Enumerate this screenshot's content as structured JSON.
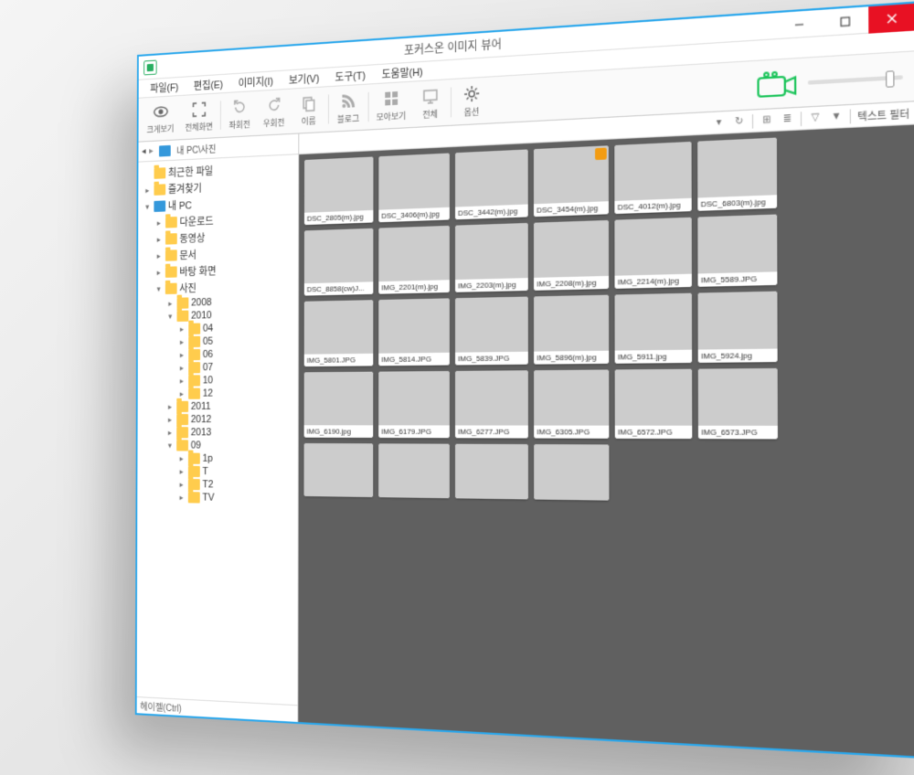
{
  "window": {
    "title": "포커스온 이미지 뷰어"
  },
  "menu": [
    "파일(F)",
    "편집(E)",
    "이미지(I)",
    "보기(V)",
    "도구(T)",
    "도움말(H)"
  ],
  "toolbar": {
    "items": [
      {
        "icon": "eye",
        "label": "크게보기"
      },
      {
        "icon": "fullscreen",
        "label": "전체화면"
      },
      {
        "icon": "rotate-left",
        "label": "좌회전"
      },
      {
        "icon": "rotate-right",
        "label": "우회전"
      },
      {
        "icon": "copy",
        "label": "이름"
      },
      {
        "icon": "rss",
        "label": "블로그"
      },
      {
        "icon": "grid",
        "label": "모아보기"
      },
      {
        "icon": "screen",
        "label": "전체"
      },
      {
        "icon": "gear",
        "label": "옵션"
      }
    ]
  },
  "breadcrumb": {
    "path": "내 PC\\사진"
  },
  "tree": [
    {
      "depth": 0,
      "arrow": "",
      "icon": "folder",
      "label": "최근한 파일"
    },
    {
      "depth": 0,
      "arrow": "▸",
      "icon": "folder",
      "label": "즐겨찾기"
    },
    {
      "depth": 0,
      "arrow": "▾",
      "icon": "pc",
      "label": "내 PC"
    },
    {
      "depth": 1,
      "arrow": "▸",
      "icon": "folder",
      "label": "다운로드"
    },
    {
      "depth": 1,
      "arrow": "▸",
      "icon": "folder",
      "label": "동영상"
    },
    {
      "depth": 1,
      "arrow": "▸",
      "icon": "folder",
      "label": "문서"
    },
    {
      "depth": 1,
      "arrow": "▸",
      "icon": "folder",
      "label": "바탕 화면"
    },
    {
      "depth": 1,
      "arrow": "▾",
      "icon": "folder",
      "label": "사진"
    },
    {
      "depth": 2,
      "arrow": "▸",
      "icon": "folder",
      "label": "2008"
    },
    {
      "depth": 2,
      "arrow": "▾",
      "icon": "folder",
      "label": "2010"
    },
    {
      "depth": 3,
      "arrow": "▸",
      "icon": "folder",
      "label": "04"
    },
    {
      "depth": 3,
      "arrow": "▸",
      "icon": "folder",
      "label": "05"
    },
    {
      "depth": 3,
      "arrow": "▸",
      "icon": "folder",
      "label": "06"
    },
    {
      "depth": 3,
      "arrow": "▸",
      "icon": "folder",
      "label": "07"
    },
    {
      "depth": 3,
      "arrow": "▸",
      "icon": "folder",
      "label": "10"
    },
    {
      "depth": 3,
      "arrow": "▸",
      "icon": "folder",
      "label": "12"
    },
    {
      "depth": 2,
      "arrow": "▸",
      "icon": "folder",
      "label": "2011"
    },
    {
      "depth": 2,
      "arrow": "▸",
      "icon": "folder",
      "label": "2012"
    },
    {
      "depth": 2,
      "arrow": "▸",
      "icon": "folder",
      "label": "2013"
    },
    {
      "depth": 2,
      "arrow": "▾",
      "icon": "folder",
      "label": "09"
    },
    {
      "depth": 3,
      "arrow": "▸",
      "icon": "folder",
      "label": "1p"
    },
    {
      "depth": 3,
      "arrow": "▸",
      "icon": "folder",
      "label": "T"
    },
    {
      "depth": 3,
      "arrow": "▸",
      "icon": "folder",
      "label": "T2"
    },
    {
      "depth": 3,
      "arrow": "▸",
      "icon": "folder",
      "label": "TV"
    }
  ],
  "status": {
    "label": "헤이젤(Ctrl)"
  },
  "viewbar": {
    "filter_label": "텍스트 필터"
  },
  "thumbs": [
    [
      {
        "name": "DSC_2805(m).jpg",
        "p": "p0"
      },
      {
        "name": "DSC_3406(m).jpg",
        "p": "p1"
      },
      {
        "name": "DSC_3442(m).jpg",
        "p": "p2"
      },
      {
        "name": "DSC_3454(m).jpg",
        "p": "p3",
        "edit": true
      },
      {
        "name": "DSC_4012(m).jpg",
        "p": "p4"
      },
      {
        "name": "DSC_6803(m).jpg",
        "p": "p5"
      }
    ],
    [
      {
        "name": "DSC_8858(cw)J...",
        "p": "p6"
      },
      {
        "name": "IMG_2201(m).jpg",
        "p": "p7"
      },
      {
        "name": "IMG_2203(m).jpg",
        "p": "p8"
      },
      {
        "name": "IMG_2208(m).jpg",
        "p": "p9"
      },
      {
        "name": "IMG_2214(m).jpg",
        "p": "p10"
      },
      {
        "name": "IMG_5589.JPG",
        "p": "p11"
      }
    ],
    [
      {
        "name": "IMG_5801.JPG",
        "p": "p12"
      },
      {
        "name": "IMG_5814.JPG",
        "p": "p13"
      },
      {
        "name": "IMG_5839.JPG",
        "p": "p14"
      },
      {
        "name": "IMG_5896(m).jpg",
        "p": "p15"
      },
      {
        "name": "IMG_5911.jpg",
        "p": "p16"
      },
      {
        "name": "IMG_5924.jpg",
        "p": "p17"
      }
    ],
    [
      {
        "name": "IMG_6190.jpg",
        "p": "p18"
      },
      {
        "name": "IMG_6179.JPG",
        "p": "p19"
      },
      {
        "name": "IMG_6277.JPG",
        "p": "p20"
      },
      {
        "name": "IMG_6305.JPG",
        "p": "p21"
      },
      {
        "name": "IMG_6572.JPG",
        "p": "p22"
      },
      {
        "name": "IMG_6573.JPG",
        "p": "p23"
      }
    ],
    [
      {
        "name": "",
        "p": "p24"
      },
      {
        "name": "",
        "p": "p25"
      },
      {
        "name": "",
        "p": "p26"
      },
      {
        "name": "",
        "p": "p27"
      }
    ]
  ]
}
